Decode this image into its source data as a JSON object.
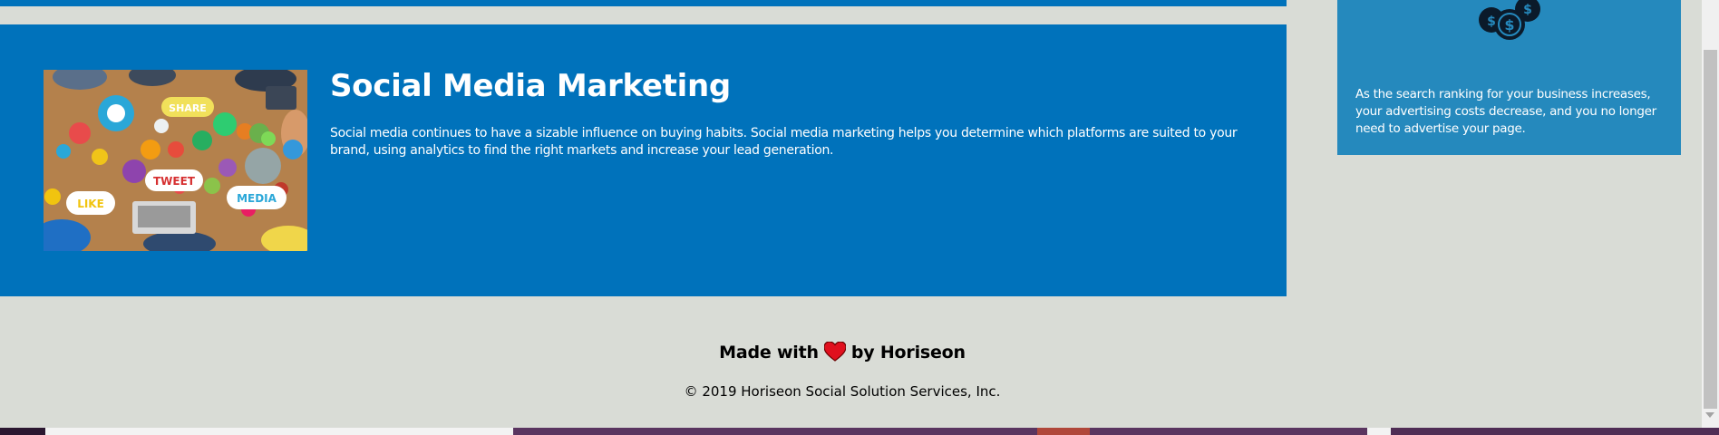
{
  "section": {
    "title": "Social Media Marketing",
    "text": "Social media continues to have a sizable influence on buying habits. Social media marketing helps you determine which platforms are suited to your brand, using analytics to find the right markets and increase your lead generation.",
    "image_alt": "social media",
    "image_bubbles": {
      "share": "SHARE",
      "tweet": "TWEET",
      "like": "LIKE",
      "media": "MEDIA"
    }
  },
  "benefit": {
    "icon": "money-bags-icon",
    "text": "As the search ranking for your business increases, your advertising costs decrease, and you no longer need to advertise your page."
  },
  "footer": {
    "made_prefix": "Made with",
    "made_suffix": "by Horiseon",
    "heart_icon": "heart-icon",
    "copyright": "© 2019 Horiseon Social Solution Services, Inc."
  },
  "colors": {
    "page_background": "#d9dcd6",
    "content_blue": "#0072bb",
    "benefit_blue": "#2589bd",
    "heart": "#e0101e"
  }
}
